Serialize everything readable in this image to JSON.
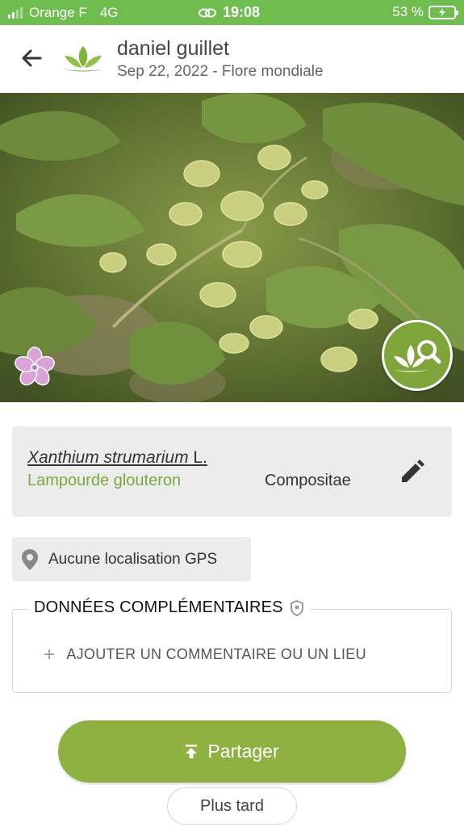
{
  "status_bar": {
    "carrier": "Orange F",
    "network": "4G",
    "time": "19:08",
    "battery": "53 %"
  },
  "header": {
    "title": "daniel guillet",
    "subtitle": "Sep 22, 2022 - Flore mondiale"
  },
  "species": {
    "scientific_name": "Xanthium strumarium",
    "author": "L.",
    "common_name": "Lampourde glouteron",
    "family": "Compositae"
  },
  "location": {
    "text": "Aucune localisation GPS"
  },
  "extra": {
    "title": "DONNÉES COMPLÉMENTAIRES",
    "add_comment": "AJOUTER UN COMMENTAIRE OU UN LIEU"
  },
  "actions": {
    "share": "Partager",
    "later": "Plus tard"
  },
  "colors": {
    "status_bar": "#6ebd4e",
    "accent_green": "#8fb141",
    "common_name": "#7aa83a",
    "card_bg": "#ececec"
  },
  "icons": {
    "back": "arrow-left-icon",
    "logo": "plantnet-leaf-icon",
    "edit": "pencil-icon",
    "location": "map-pin-icon",
    "privacy": "shield-icon",
    "add": "plus-icon",
    "share": "upload-icon",
    "identify": "leaf-search-icon",
    "flower": "flower-icon"
  }
}
